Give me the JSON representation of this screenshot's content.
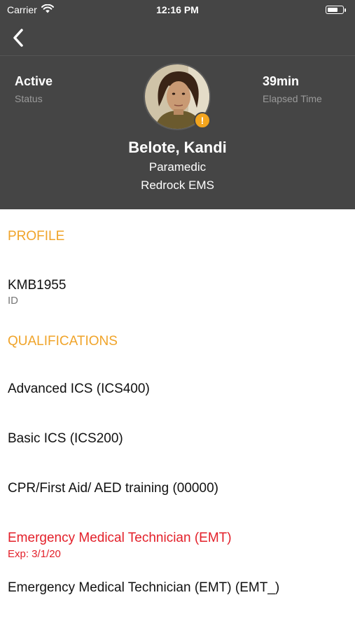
{
  "status_bar": {
    "carrier": "Carrier",
    "time": "12:16 PM",
    "battery_level": 0.7
  },
  "nav": {
    "back_icon": "chevron-left-icon"
  },
  "header": {
    "status_value": "Active",
    "status_label": "Status",
    "elapsed_value": "39min",
    "elapsed_label": "Elapsed Time",
    "name": "Belote, Kandi",
    "role": "Paramedic",
    "organization": "Redrock EMS",
    "alert_badge": "!",
    "alert_color": "#f3a51e",
    "background_color": "#454545"
  },
  "profile": {
    "section_title": "PROFILE",
    "id_value": "KMB1955",
    "id_label": "ID"
  },
  "qualifications": {
    "section_title": "QUALIFICATIONS",
    "items": [
      {
        "label": "Advanced ICS (ICS400)"
      },
      {
        "label": "Basic ICS (ICS200)"
      },
      {
        "label": "CPR/First Aid/ AED training (00000)"
      },
      {
        "label": "Emergency Medical Technician (EMT)",
        "expiry": "Exp: 3/1/20",
        "expired": true
      },
      {
        "label": "Emergency Medical Technician (EMT) (EMT_)"
      }
    ]
  },
  "colors": {
    "section_accent": "#f0a42a",
    "expired_red": "#e3202a"
  }
}
